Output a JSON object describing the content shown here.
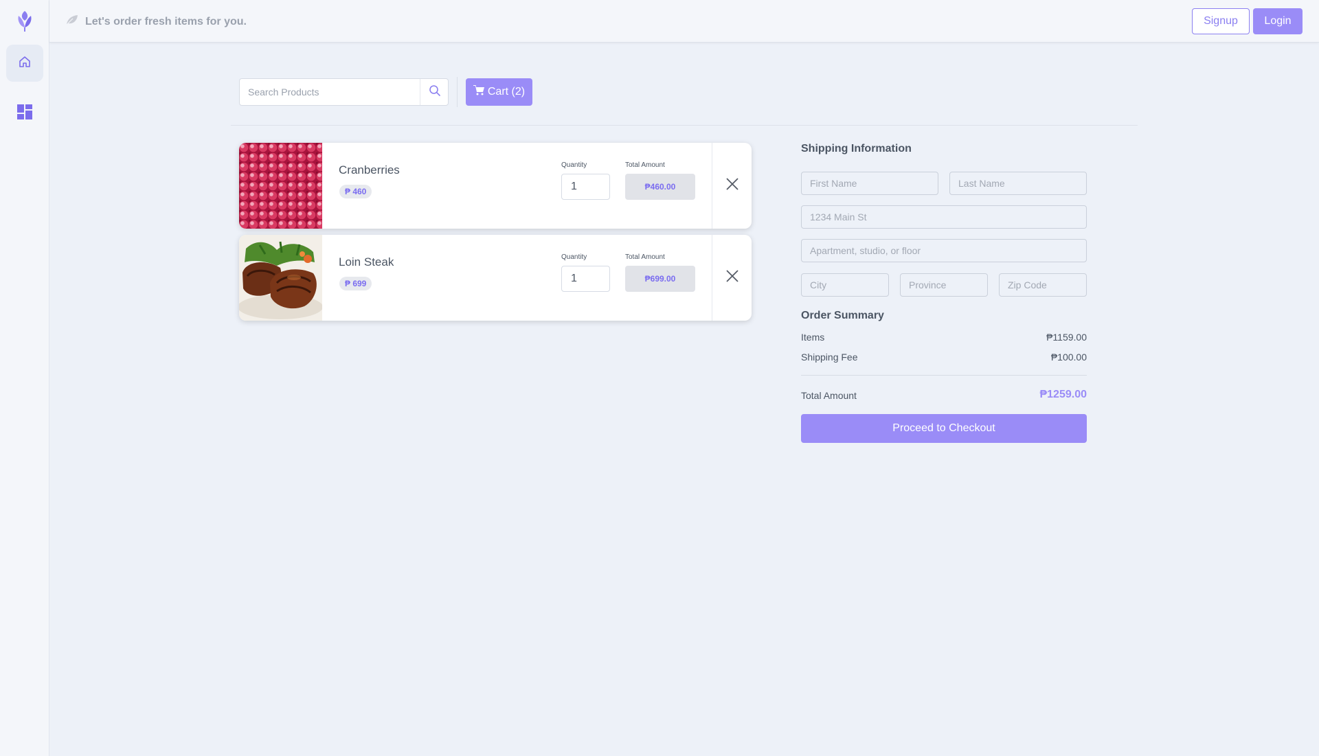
{
  "header": {
    "tagline": "Let's order fresh items for you.",
    "signup_label": "Signup",
    "login_label": "Login"
  },
  "sidebar": {
    "items": [
      {
        "icon": "home-icon",
        "active": true
      },
      {
        "icon": "dashboard-icon",
        "active": false
      }
    ]
  },
  "search": {
    "placeholder": "Search Products"
  },
  "cart_button": {
    "label": "Cart (2)"
  },
  "cart": {
    "quantity_label": "Quantity",
    "total_label": "Total Amount",
    "items": [
      {
        "name": "Cranberries",
        "price": "₱ 460",
        "quantity": "1",
        "total": "₱460.00",
        "image": "cranberries"
      },
      {
        "name": "Loin Steak",
        "price": "₱ 699",
        "quantity": "1",
        "total": "₱699.00",
        "image": "loin steak"
      }
    ]
  },
  "shipping": {
    "title": "Shipping Information",
    "first_name_placeholder": "First Name",
    "last_name_placeholder": "Last Name",
    "address_placeholder": "1234 Main St",
    "address2_placeholder": "Apartment, studio, or floor",
    "city_placeholder": "City",
    "province_placeholder": "Province",
    "zip_placeholder": "Zip Code"
  },
  "summary": {
    "title": "Order Summary",
    "items_label": "Items",
    "items_value": "₱1159.00",
    "shipping_label": "Shipping Fee",
    "shipping_value": "₱100.00",
    "total_label": "Total Amount",
    "total_value": "₱1259.00",
    "checkout_label": "Proceed to Checkout"
  },
  "colors": {
    "accent": "#9a8cf7",
    "accent_text": "#7a6cf0",
    "background": "#edf1f8"
  }
}
